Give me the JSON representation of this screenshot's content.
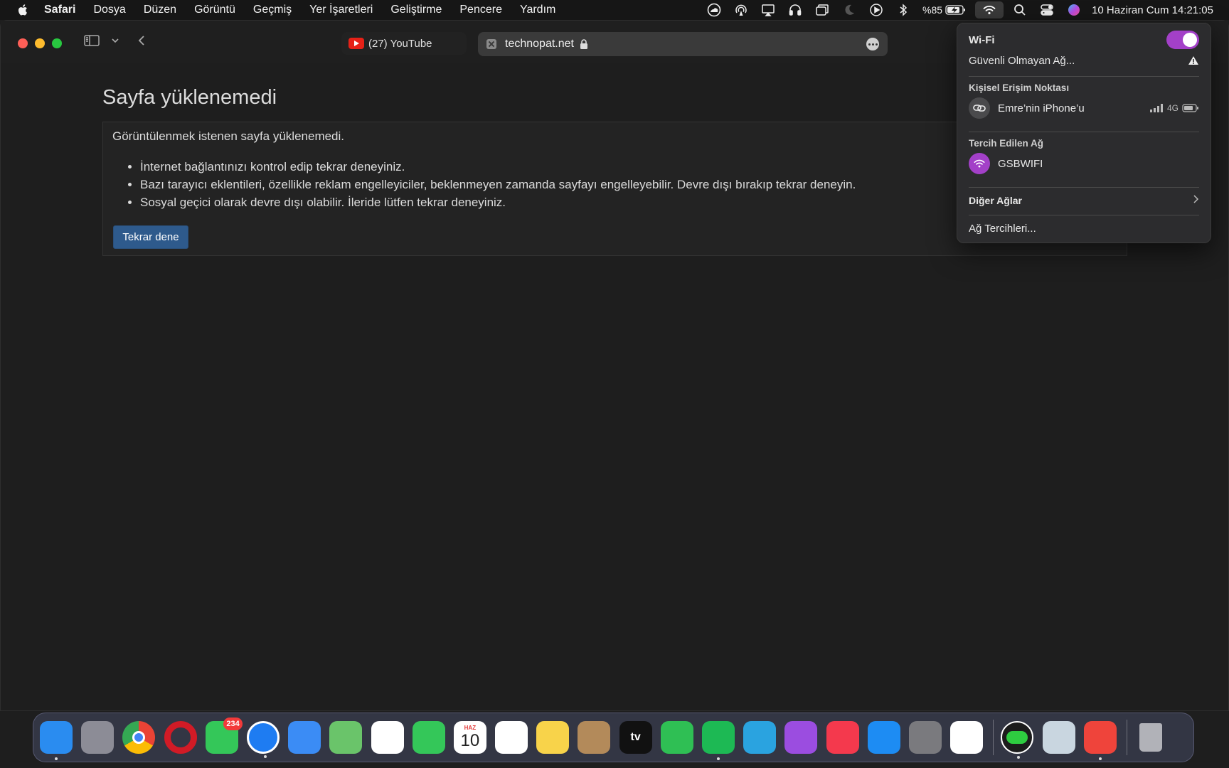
{
  "menubar": {
    "app_name": "Safari",
    "items": [
      "Dosya",
      "Düzen",
      "Görüntü",
      "Geçmiş",
      "Yer İşaretleri",
      "Geliştirme",
      "Pencere",
      "Yardım"
    ],
    "battery_text": "%85",
    "datetime": "10 Haziran Cum  14:21:05",
    "status_icons": [
      "creative-cloud-icon",
      "airdrop-icon",
      "display-icon",
      "headphones-icon",
      "window-icon",
      "moon-icon",
      "play-icon",
      "bluetooth-icon",
      "battery-icon",
      "wifi-icon",
      "search-icon",
      "control-center-icon",
      "siri-icon"
    ]
  },
  "browser": {
    "tabs": [
      {
        "label": "(27) YouTube",
        "favicon": "youtube-icon"
      },
      {
        "label": "technopat.net",
        "secure": true
      }
    ]
  },
  "page": {
    "title": "Sayfa yüklenemedi",
    "message": "Görüntülenmek istenen sayfa yüklenemedi.",
    "tips": [
      "İnternet bağlantınızı kontrol edip tekrar deneyiniz.",
      "Bazı tarayıcı eklentileri, özellikle reklam engelleyiciler, beklenmeyen zamanda sayfayı engelleyebilir. Devre dışı bırakıp tekrar deneyin.",
      "Sosyal geçici olarak devre dışı olabilir. İleride lütfen tekrar deneyiniz."
    ],
    "retry_label": "Tekrar dene"
  },
  "wifi_menu": {
    "title": "Wi-Fi",
    "enabled": true,
    "current_network": "Güvenli Olmayan Ağ...",
    "hotspot_section": "Kişisel Erişim Noktası",
    "hotspot_name": "Emre’nin iPhone’u",
    "hotspot_network": "4G",
    "preferred_section": "Tercih Edilen Ağ",
    "preferred_network": "GSBWIFI",
    "other_networks": "Diğer Ağlar",
    "preferences": "Ağ Tercihleri...",
    "accent_color": "#a340c8"
  },
  "dock": {
    "apps": [
      {
        "name": "finder",
        "color": "#2a8cf0",
        "running": true
      },
      {
        "name": "launchpad",
        "color": "#8c8c96"
      },
      {
        "name": "chrome",
        "color": "#ffffff"
      },
      {
        "name": "opera",
        "color": "#d11b26"
      },
      {
        "name": "messages",
        "color": "#34c759",
        "badge": "234"
      },
      {
        "name": "safari",
        "color": "#1e7cf2",
        "running": true
      },
      {
        "name": "mail",
        "color": "#3b8cf5"
      },
      {
        "name": "maps",
        "color": "#6ac46a"
      },
      {
        "name": "photos",
        "color": "#ffffff"
      },
      {
        "name": "facetime",
        "color": "#34c759"
      },
      {
        "name": "calendar",
        "color": "#ffffff",
        "month": "HAZ",
        "day": "10"
      },
      {
        "name": "reminders",
        "color": "#ffffff"
      },
      {
        "name": "notes",
        "color": "#f8d34a"
      },
      {
        "name": "contacts",
        "color": "#b38a5a"
      },
      {
        "name": "apple-tv",
        "color": "#111111",
        "label": "tv"
      },
      {
        "name": "whatsapp",
        "color": "#2fbf54"
      },
      {
        "name": "spotify",
        "color": "#1db954",
        "running": true
      },
      {
        "name": "telegram",
        "color": "#2aa3e0"
      },
      {
        "name": "podcasts",
        "color": "#9b4de0"
      },
      {
        "name": "music",
        "color": "#f4394d"
      },
      {
        "name": "app-store",
        "color": "#1d8cf3"
      },
      {
        "name": "system-preferences",
        "color": "#7a7a7e"
      },
      {
        "name": "vscode",
        "color": "#ffffff"
      },
      {
        "name": "cloud-app",
        "color": "#2ecc40",
        "running": true
      },
      {
        "name": "preview",
        "color": "#c9d6e0"
      },
      {
        "name": "anydesk",
        "color": "#ef443b",
        "running": true
      },
      {
        "name": "trash",
        "color": "#c8c8cc"
      }
    ]
  }
}
